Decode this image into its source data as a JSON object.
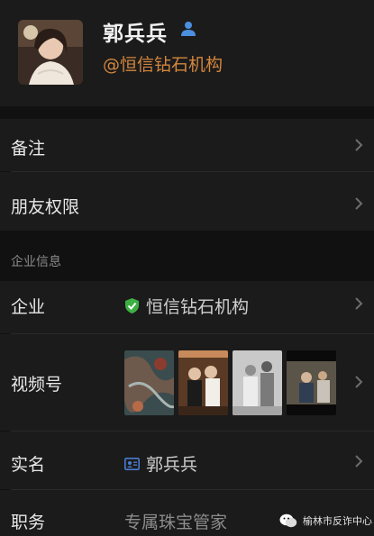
{
  "profile": {
    "name": "郭兵兵",
    "organization": "@恒信钻石机构",
    "name_icon": "person-badge-icon"
  },
  "rows": {
    "remark": {
      "label": "备注"
    },
    "friend_permission": {
      "label": "朋友权限"
    },
    "enterprise": {
      "label": "企业",
      "value": "恒信钻石机构",
      "icon": "verified-shield-icon"
    },
    "channels": {
      "label": "视频号"
    },
    "real_name": {
      "label": "实名",
      "value": "郭兵兵",
      "icon": "id-card-icon"
    },
    "position": {
      "label": "职务",
      "value": "专属珠宝管家"
    }
  },
  "section": {
    "title": "企业信息"
  },
  "watermark": {
    "text": "榆林市反诈中心"
  },
  "colors": {
    "background": "#111111",
    "row_background": "#1b1b1b",
    "org_text": "#d3863e",
    "verified_green": "#3cb043",
    "id_blue": "#4a7bd0"
  }
}
